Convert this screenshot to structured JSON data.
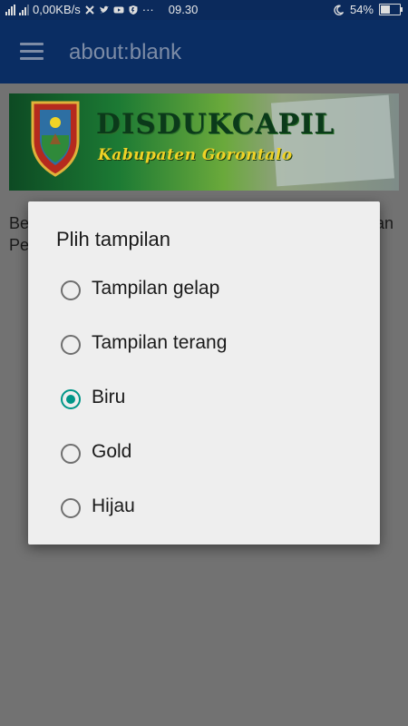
{
  "status_bar": {
    "network_speed": "0,00KB/s",
    "more": "···",
    "time": "09.30",
    "battery": "54%",
    "battery_level": 0.54
  },
  "app_bar": {
    "title": "about:blank",
    "menu_icon": "hamburger-menu-icon"
  },
  "banner": {
    "title": "DISDUKCAPIL",
    "subtitle": "Kabupaten Gorontalo"
  },
  "page_text": {
    "line1_left": "Be",
    "line1_right": "an",
    "line2_left": "Pe"
  },
  "dialog": {
    "title": "Plih tampilan",
    "options": [
      {
        "label": "Tampilan gelap",
        "selected": false
      },
      {
        "label": "Tampilan terang",
        "selected": false
      },
      {
        "label": "Biru",
        "selected": true
      },
      {
        "label": "Gold",
        "selected": false
      },
      {
        "label": "Hijau",
        "selected": false
      }
    ]
  },
  "colors": {
    "status_bar": "#0b2a5c",
    "app_bar": "#0a2d63",
    "accent": "#009688",
    "dialog_bg": "#eeeeee",
    "scrim_bg": "#727272"
  }
}
